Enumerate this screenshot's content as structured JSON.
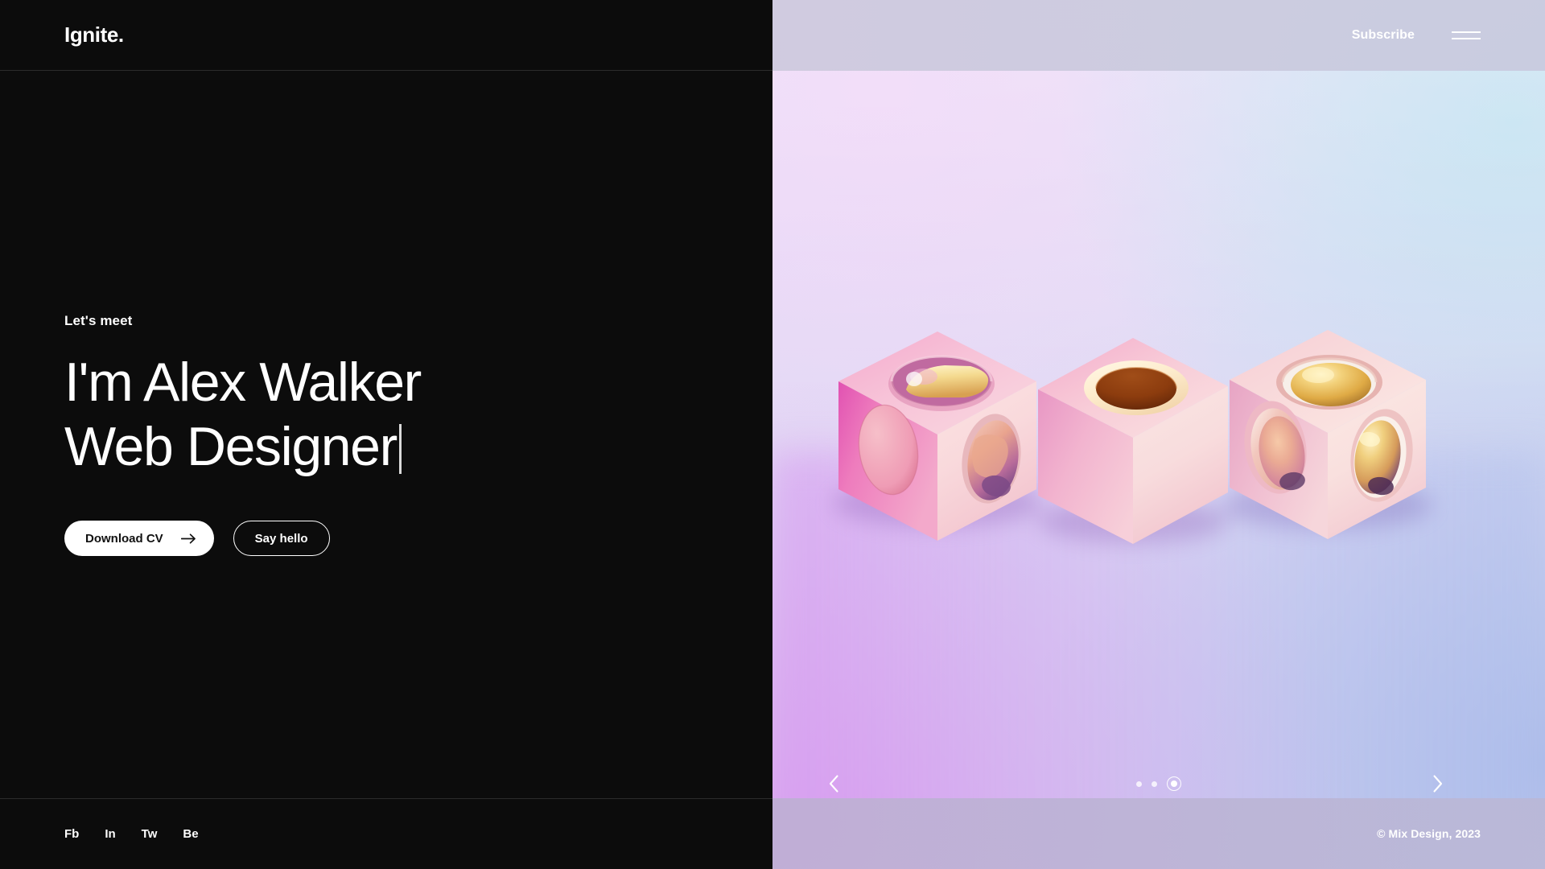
{
  "header": {
    "logo": "Ignite.",
    "subscribe_label": "Subscribe",
    "menu_icon": "hamburger-menu-icon"
  },
  "hero": {
    "eyebrow": "Let's meet",
    "headline_line1": "I'm Alex Walker",
    "headline_line2": "Web Designer",
    "typing_caret": true,
    "primary_button": {
      "label": "Download CV",
      "icon": "arrow-right-icon"
    },
    "secondary_button": {
      "label": "Say hello"
    }
  },
  "footer": {
    "social_links": [
      {
        "label": "Fb",
        "name": "facebook"
      },
      {
        "label": "In",
        "name": "linkedin"
      },
      {
        "label": "Tw",
        "name": "twitter"
      },
      {
        "label": "Be",
        "name": "behance"
      }
    ],
    "copyright": "© Mix Design, 2023"
  },
  "carousel": {
    "prev_icon": "chevron-left-icon",
    "next_icon": "chevron-right-icon",
    "slide_count": 3,
    "active_slide": 3,
    "illustration": "three-isometric-pink-cubes-with-gold-spheres"
  },
  "colors": {
    "dark_panel": "#0c0c0c",
    "text_on_dark": "#ffffff",
    "header_right_bg": "#cdc9de",
    "footer_right_bg": "#beafd4",
    "gradient_pink": "#dba7ef",
    "gradient_lavender": "#e2dcf5",
    "gradient_blue": "#aebcea",
    "gradient_cyan": "#bfe0f0",
    "cube_pink": "#f0b8d4",
    "cube_magenta": "#e063b8",
    "cube_cream": "#f7e2e0",
    "gold": "#e8c25c",
    "accent_brown": "#8a3d10"
  }
}
